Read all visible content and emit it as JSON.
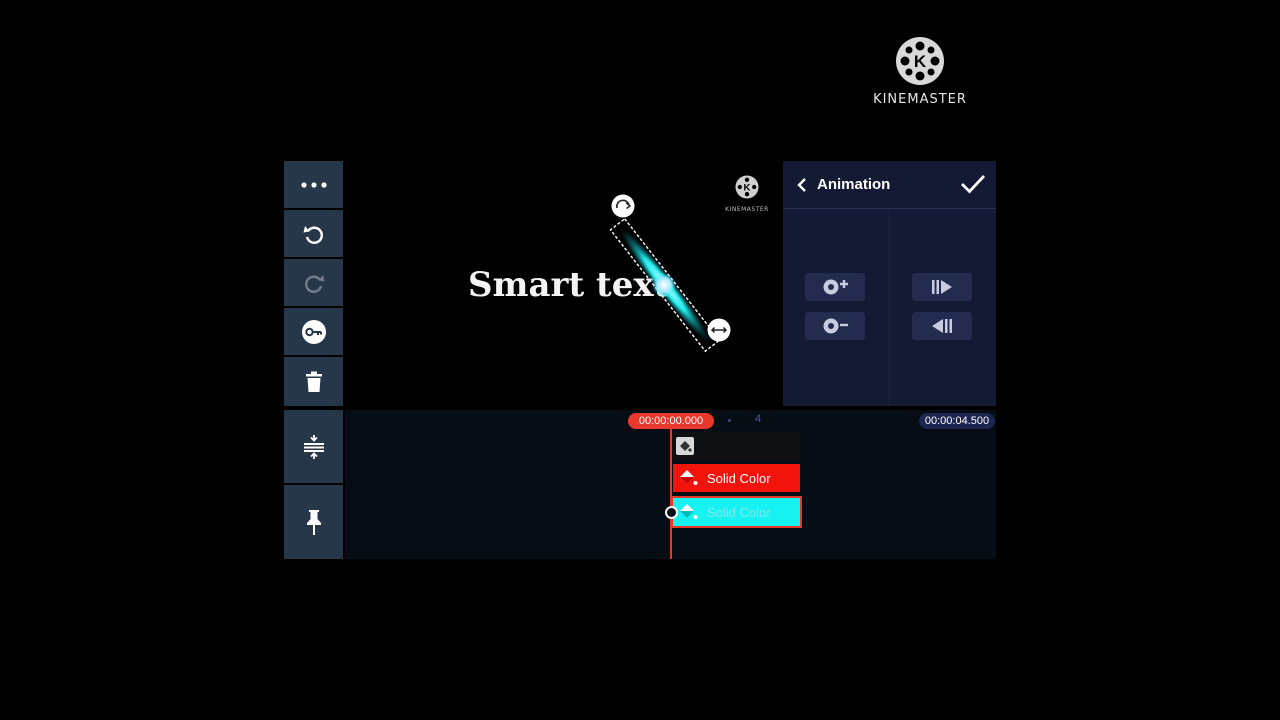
{
  "watermark": {
    "brand": "KINEMASTER",
    "logo_letter": "K"
  },
  "toolbar": {
    "items": [
      {
        "name": "more-menu-button",
        "icon": "ellipsis-icon",
        "enabled": true
      },
      {
        "name": "undo-button",
        "icon": "undo-icon",
        "enabled": true
      },
      {
        "name": "redo-button",
        "icon": "redo-icon",
        "enabled": false
      },
      {
        "name": "keyframe-button",
        "icon": "key-icon",
        "enabled": true
      },
      {
        "name": "delete-button",
        "icon": "trash-icon",
        "enabled": true
      }
    ]
  },
  "preview": {
    "text_layer": "Smart text",
    "inner_watermark": "KINEMASTER",
    "beam_color": "#1de9e9"
  },
  "animation_panel": {
    "title": "Animation",
    "buttons": [
      {
        "name": "add-keyframe",
        "icon": "add-keyframe-icon"
      },
      {
        "name": "remove-keyframe",
        "icon": "remove-keyframe-icon"
      },
      {
        "name": "next-keyframe",
        "icon": "next-keyframe-icon"
      },
      {
        "name": "prev-keyframe",
        "icon": "prev-keyframe-icon"
      }
    ]
  },
  "timeline": {
    "current_time": "00:00:00.000",
    "tick_label": "4",
    "end_time": "00:00:04.500",
    "clips": [
      {
        "label": "Solid Color",
        "color": "#f2140c",
        "selected": false
      },
      {
        "label": "Solid Color",
        "color": "#16f1f1",
        "selected": true
      }
    ],
    "tools": [
      {
        "name": "expand-timeline-button",
        "icon": "expand-vertical-icon"
      },
      {
        "name": "pin-button",
        "icon": "pin-icon"
      }
    ]
  },
  "colors": {
    "toolbar_bg": "#26374a",
    "panel_bg": "#141a33",
    "playhead": "#e8372b",
    "accent_cyan": "#16f1f1"
  }
}
